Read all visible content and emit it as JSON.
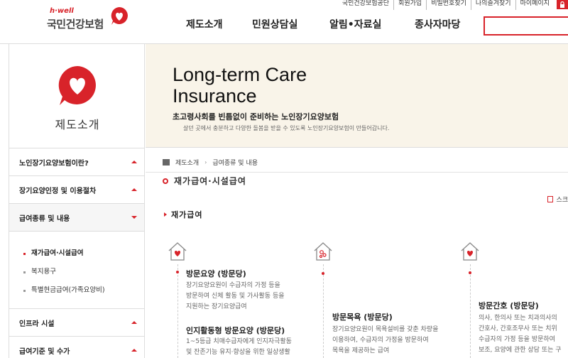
{
  "header": {
    "logo_tagline": "h·well",
    "logo_name": "국민건강보험",
    "util_links": [
      "국민건강보험공단",
      "회원가입",
      "비밀번호찾기",
      "나의즐겨찾기",
      "마이페이지"
    ],
    "gnb": [
      "제도소개",
      "민원상담실",
      "알림•자료실",
      "종사자마당"
    ]
  },
  "side": {
    "title": "제도소개",
    "menu": [
      {
        "label": "노인장기요양보험이란?",
        "state": "up"
      },
      {
        "label": "장기요양인정 및 이용절차",
        "state": "up"
      },
      {
        "label": "급여종류 및 내용",
        "state": "down"
      }
    ],
    "submenu": [
      "재가급여·시설급여",
      "복지용구",
      "특별현금급여(가족요양비)"
    ],
    "menu_after": [
      {
        "label": "인프라 시설",
        "state": "up"
      },
      {
        "label": "급여기준 및 수가",
        "state": "up"
      }
    ]
  },
  "banner": {
    "title_line1": "Long-term Care",
    "title_line2": "Insurance",
    "subtitle": "초고령사회를 빈틈없이 준비하는 노인장기요양보험",
    "desc": "살던 곳에서 충분하고 다양한 돌봄을 받을 수 있도록 노인장기요양보험이 만들어갑니다."
  },
  "content": {
    "breadcrumb": [
      "제도소개",
      "급여종류 및 내용"
    ],
    "page_title": "재가급여·시설급여",
    "scrap_label": "스크",
    "section_title": "재가급여",
    "services": [
      {
        "name": "방문요양 (방문당)",
        "desc_lines": [
          "장기요양요원이 수급자의 가정 등을",
          "방문하여 신체 활동 및 가사활동 등을",
          "지원하는 장기요양급여"
        ],
        "name2": "인지활동형 방문요양 (방문당)",
        "desc2_lines": [
          "1~5등급 치매수급자에게 인지자극활동",
          "및 잔존기능 유지·향상을 위한 일상생활"
        ]
      },
      {
        "name": "방문목욕 (방문당)",
        "desc_lines": [
          "장기요양요원이 목욕설비를 갖춘 차량을",
          "이용하여, 수급자의 가정을 방문하여",
          "목욕을 제공하는 급여"
        ]
      },
      {
        "name": "방문간호 (방문당)",
        "desc_lines": [
          "의사, 한의사 또는 치과의사의",
          "간호사, 간호조무사 또는 치위",
          "수급자의 가정 등을 방문하여",
          "보조, 요양에 관한 상담 또는 구"
        ]
      }
    ]
  },
  "colors": {
    "accent": "#d8232a",
    "banner_bg": "#f9f4e9"
  }
}
